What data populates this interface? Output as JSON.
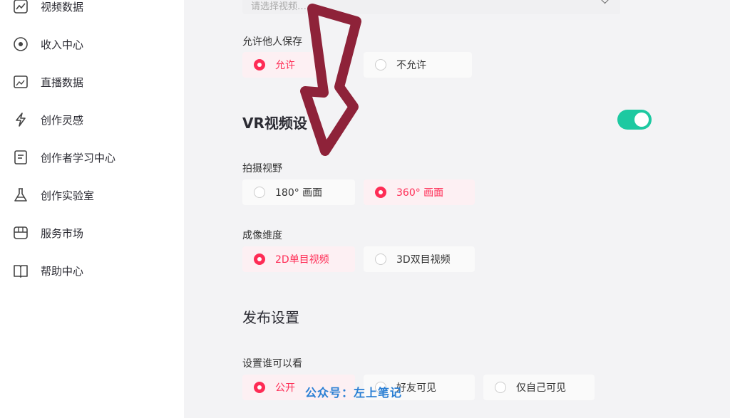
{
  "sidebar": {
    "items": [
      {
        "label": "视频数据",
        "icon": "chart-icon"
      },
      {
        "label": "收入中心",
        "icon": "coin-icon"
      },
      {
        "label": "直播数据",
        "icon": "live-image-icon"
      },
      {
        "label": "创作灵感",
        "icon": "lightning-icon"
      },
      {
        "label": "创作者学习中心",
        "icon": "document-icon"
      },
      {
        "label": "创作实验室",
        "icon": "flask-icon"
      },
      {
        "label": "服务市场",
        "icon": "store-icon"
      },
      {
        "label": "帮助中心",
        "icon": "book-icon"
      }
    ]
  },
  "form": {
    "select_placeholder": "请选择视频…",
    "allow_save": {
      "label": "允许他人保存",
      "options": [
        {
          "label": "允许",
          "selected": true
        },
        {
          "label": "不允许",
          "selected": false
        }
      ]
    },
    "vr": {
      "title": "VR视频设",
      "toggle_on": true,
      "view": {
        "label": "拍摄视野",
        "options": [
          {
            "label": "180° 画面",
            "selected": false
          },
          {
            "label": "360° 画面",
            "selected": true
          }
        ]
      },
      "dimension": {
        "label": "成像维度",
        "options": [
          {
            "label": "2D单目视频",
            "selected": true
          },
          {
            "label": "3D双目视频",
            "selected": false
          }
        ]
      }
    },
    "publish": {
      "title": "发布设置",
      "who_can_see": {
        "label": "设置谁可以看",
        "options": [
          {
            "label": "公开",
            "selected": true
          },
          {
            "label": "好友可见",
            "selected": false
          },
          {
            "label": "仅自己可见",
            "selected": false
          }
        ]
      }
    }
  },
  "overlay": {
    "watermark": "公众号：左上笔记",
    "arrow_color": "#8e2239"
  },
  "colors": {
    "accent": "#fe2c55",
    "toggle": "#1dc9a1"
  }
}
